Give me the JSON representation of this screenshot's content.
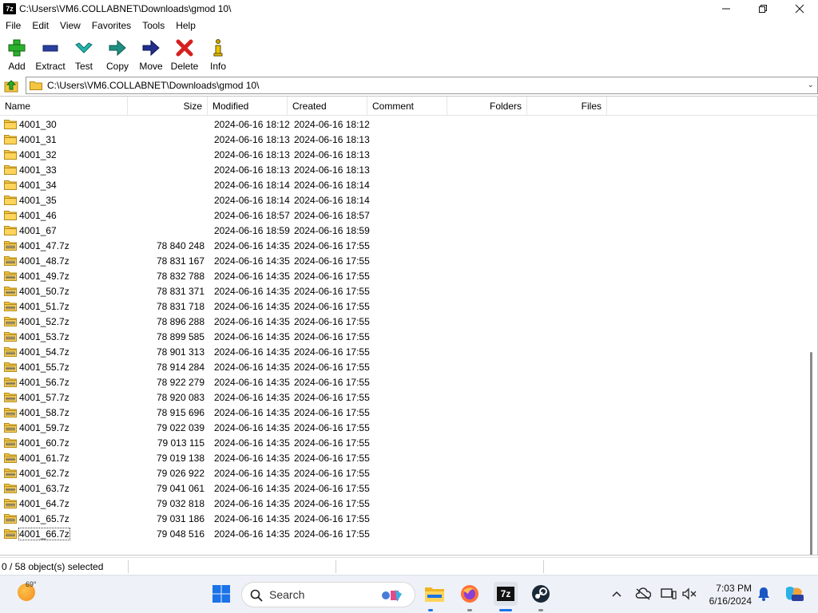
{
  "window": {
    "app_icon_text": "7z",
    "title": "C:\\Users\\VM6.COLLABNET\\Downloads\\gmod 10\\"
  },
  "menu": [
    "File",
    "Edit",
    "View",
    "Favorites",
    "Tools",
    "Help"
  ],
  "toolbar": {
    "add": "Add",
    "extract": "Extract",
    "test": "Test",
    "copy": "Copy",
    "move": "Move",
    "delete": "Delete",
    "info": "Info"
  },
  "address": {
    "path": "C:\\Users\\VM6.COLLABNET\\Downloads\\gmod 10\\"
  },
  "columns": {
    "name": "Name",
    "size": "Size",
    "modified": "Modified",
    "created": "Created",
    "comment": "Comment",
    "folders": "Folders",
    "files": "Files"
  },
  "rows": [
    {
      "name": "4001_30",
      "type": "folder",
      "size": "",
      "modified": "2024-06-16 18:12",
      "created": "2024-06-16 18:12"
    },
    {
      "name": "4001_31",
      "type": "folder",
      "size": "",
      "modified": "2024-06-16 18:13",
      "created": "2024-06-16 18:13"
    },
    {
      "name": "4001_32",
      "type": "folder",
      "size": "",
      "modified": "2024-06-16 18:13",
      "created": "2024-06-16 18:13"
    },
    {
      "name": "4001_33",
      "type": "folder",
      "size": "",
      "modified": "2024-06-16 18:13",
      "created": "2024-06-16 18:13"
    },
    {
      "name": "4001_34",
      "type": "folder",
      "size": "",
      "modified": "2024-06-16 18:14",
      "created": "2024-06-16 18:14"
    },
    {
      "name": "4001_35",
      "type": "folder",
      "size": "",
      "modified": "2024-06-16 18:14",
      "created": "2024-06-16 18:14"
    },
    {
      "name": "4001_46",
      "type": "folder",
      "size": "",
      "modified": "2024-06-16 18:57",
      "created": "2024-06-16 18:57"
    },
    {
      "name": "4001_67",
      "type": "folder",
      "size": "",
      "modified": "2024-06-16 18:59",
      "created": "2024-06-16 18:59"
    },
    {
      "name": "4001_47.7z",
      "type": "archive",
      "size": "78 840 248",
      "modified": "2024-06-16 14:35",
      "created": "2024-06-16 17:55"
    },
    {
      "name": "4001_48.7z",
      "type": "archive",
      "size": "78 831 167",
      "modified": "2024-06-16 14:35",
      "created": "2024-06-16 17:55"
    },
    {
      "name": "4001_49.7z",
      "type": "archive",
      "size": "78 832 788",
      "modified": "2024-06-16 14:35",
      "created": "2024-06-16 17:55"
    },
    {
      "name": "4001_50.7z",
      "type": "archive",
      "size": "78 831 371",
      "modified": "2024-06-16 14:35",
      "created": "2024-06-16 17:55"
    },
    {
      "name": "4001_51.7z",
      "type": "archive",
      "size": "78 831 718",
      "modified": "2024-06-16 14:35",
      "created": "2024-06-16 17:55"
    },
    {
      "name": "4001_52.7z",
      "type": "archive",
      "size": "78 896 288",
      "modified": "2024-06-16 14:35",
      "created": "2024-06-16 17:55"
    },
    {
      "name": "4001_53.7z",
      "type": "archive",
      "size": "78 899 585",
      "modified": "2024-06-16 14:35",
      "created": "2024-06-16 17:55"
    },
    {
      "name": "4001_54.7z",
      "type": "archive",
      "size": "78 901 313",
      "modified": "2024-06-16 14:35",
      "created": "2024-06-16 17:55"
    },
    {
      "name": "4001_55.7z",
      "type": "archive",
      "size": "78 914 284",
      "modified": "2024-06-16 14:35",
      "created": "2024-06-16 17:55"
    },
    {
      "name": "4001_56.7z",
      "type": "archive",
      "size": "78 922 279",
      "modified": "2024-06-16 14:35",
      "created": "2024-06-16 17:55"
    },
    {
      "name": "4001_57.7z",
      "type": "archive",
      "size": "78 920 083",
      "modified": "2024-06-16 14:35",
      "created": "2024-06-16 17:55"
    },
    {
      "name": "4001_58.7z",
      "type": "archive",
      "size": "78 915 696",
      "modified": "2024-06-16 14:35",
      "created": "2024-06-16 17:55"
    },
    {
      "name": "4001_59.7z",
      "type": "archive",
      "size": "79 022 039",
      "modified": "2024-06-16 14:35",
      "created": "2024-06-16 17:55"
    },
    {
      "name": "4001_60.7z",
      "type": "archive",
      "size": "79 013 115",
      "modified": "2024-06-16 14:35",
      "created": "2024-06-16 17:55"
    },
    {
      "name": "4001_61.7z",
      "type": "archive",
      "size": "79 019 138",
      "modified": "2024-06-16 14:35",
      "created": "2024-06-16 17:55"
    },
    {
      "name": "4001_62.7z",
      "type": "archive",
      "size": "79 026 922",
      "modified": "2024-06-16 14:35",
      "created": "2024-06-16 17:55"
    },
    {
      "name": "4001_63.7z",
      "type": "archive",
      "size": "79 041 061",
      "modified": "2024-06-16 14:35",
      "created": "2024-06-16 17:55"
    },
    {
      "name": "4001_64.7z",
      "type": "archive",
      "size": "79 032 818",
      "modified": "2024-06-16 14:35",
      "created": "2024-06-16 17:55"
    },
    {
      "name": "4001_65.7z",
      "type": "archive",
      "size": "79 031 186",
      "modified": "2024-06-16 14:35",
      "created": "2024-06-16 17:55"
    },
    {
      "name": "4001_66.7z",
      "type": "archive",
      "size": "79 048 516",
      "modified": "2024-06-16 14:35",
      "created": "2024-06-16 17:55",
      "focused": true
    }
  ],
  "status": {
    "selection": "0 / 58 object(s) selected"
  },
  "taskbar": {
    "weather_temp": "69°",
    "search_label": "Search",
    "time": "7:03 PM",
    "date": "6/16/2024",
    "apps": [
      "start-icon",
      "file-explorer-icon",
      "firefox-icon",
      "7zip-icon",
      "steam-icon"
    ],
    "seven_zip_label": "7z"
  },
  "colors": {
    "folder": "#f4c542",
    "add_green": "#2bb02b",
    "extract_blue": "#2a3f9e",
    "delete_red": "#d61f1f",
    "accent": "#1a73e8"
  }
}
